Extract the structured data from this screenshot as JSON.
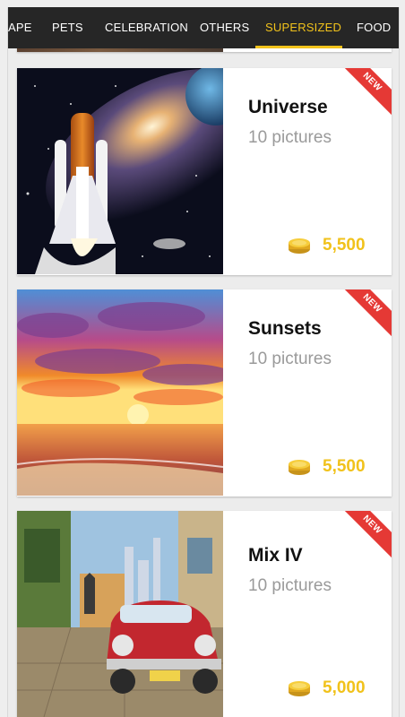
{
  "tabs": [
    {
      "label": "APE",
      "active": false
    },
    {
      "label": "PETS",
      "active": false
    },
    {
      "label": "CELEBRATION",
      "active": false
    },
    {
      "label": "OTHERS",
      "active": false
    },
    {
      "label": "SUPERSIZED",
      "active": true
    },
    {
      "label": "FOOD",
      "active": false
    }
  ],
  "cards": [
    {
      "title": "Universe",
      "subtitle": "10 pictures",
      "price": "5,500",
      "badge": "NEW"
    },
    {
      "title": "Sunsets",
      "subtitle": "10 pictures",
      "price": "5,500",
      "badge": "NEW"
    },
    {
      "title": "Mix IV",
      "subtitle": "10 pictures",
      "price": "5,000",
      "badge": "NEW"
    }
  ],
  "colors": {
    "accent": "#f1c21b",
    "tabbar": "#262626",
    "badge": "#e53935"
  },
  "icons": {
    "coin": "coin-stack-icon",
    "thumbnails": [
      "universe-shuttle-image",
      "sunset-sea-image",
      "mix-iv-street-car-image"
    ]
  }
}
